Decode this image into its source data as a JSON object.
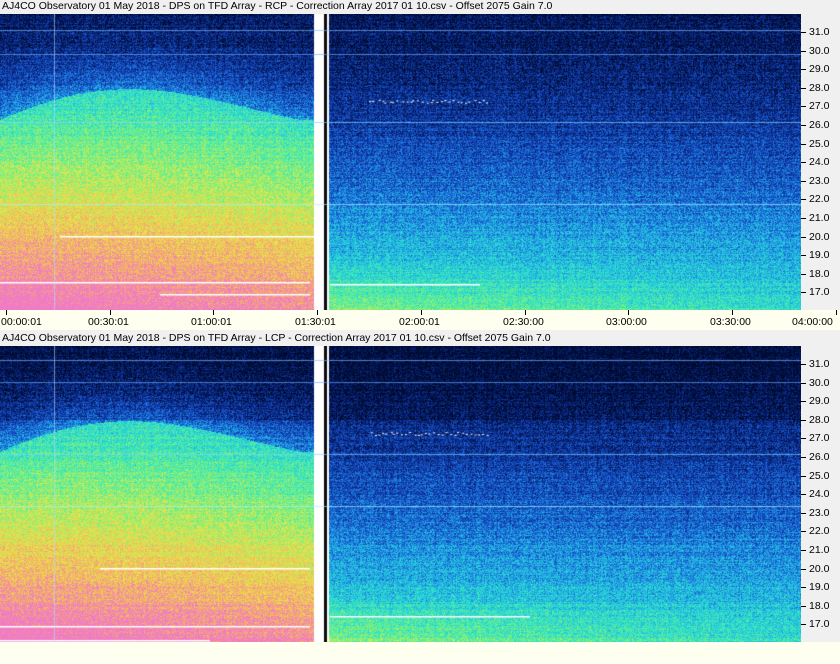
{
  "panels": [
    {
      "id": "rcp",
      "title": "AJ4CO Observatory 01 May 2018  -  DPS on TFD Array  -  RCP  -  Correction Array 2017 01 10.csv  -  Offset 2075  Gain 7.0",
      "polarization": "RCP",
      "x_tick_labels": [
        "00:00:01",
        "00:30:01",
        "01:00:01",
        "01:30:01",
        "02:00:01",
        "02:30:00",
        "03:00:00",
        "03:30:00",
        "04:00:00"
      ],
      "y_tick_labels": [
        "31.0",
        "30.0",
        "29.0",
        "28.0",
        "27.0",
        "26.0",
        "25.0",
        "24.0",
        "23.0",
        "22.0",
        "21.0",
        "20.0",
        "19.0",
        "18.0",
        "17.0"
      ]
    },
    {
      "id": "lcp",
      "title": "AJ4CO Observatory 01 May 2018  -  DPS on TFD Array  -  LCP  -  Correction Array 2017 01 10.csv  -  Offset 2075  Gain 7.0",
      "polarization": "LCP",
      "x_tick_labels": [],
      "y_tick_labels": [
        "31.0",
        "30.0",
        "29.0",
        "28.0",
        "27.0",
        "26.0",
        "25.0",
        "24.0",
        "23.0",
        "22.0",
        "21.0",
        "20.0",
        "19.0",
        "18.0",
        "17.0"
      ]
    }
  ],
  "colors": {
    "background": "#f0f0f0",
    "xaxis_background": "#fffff0",
    "colormap": [
      "#000a2e",
      "#0a2a8c",
      "#1a5fd6",
      "#22b4e6",
      "#2ee6c8",
      "#7cf07a",
      "#e6e84a",
      "#f5b65a",
      "#f07ac8"
    ]
  }
}
